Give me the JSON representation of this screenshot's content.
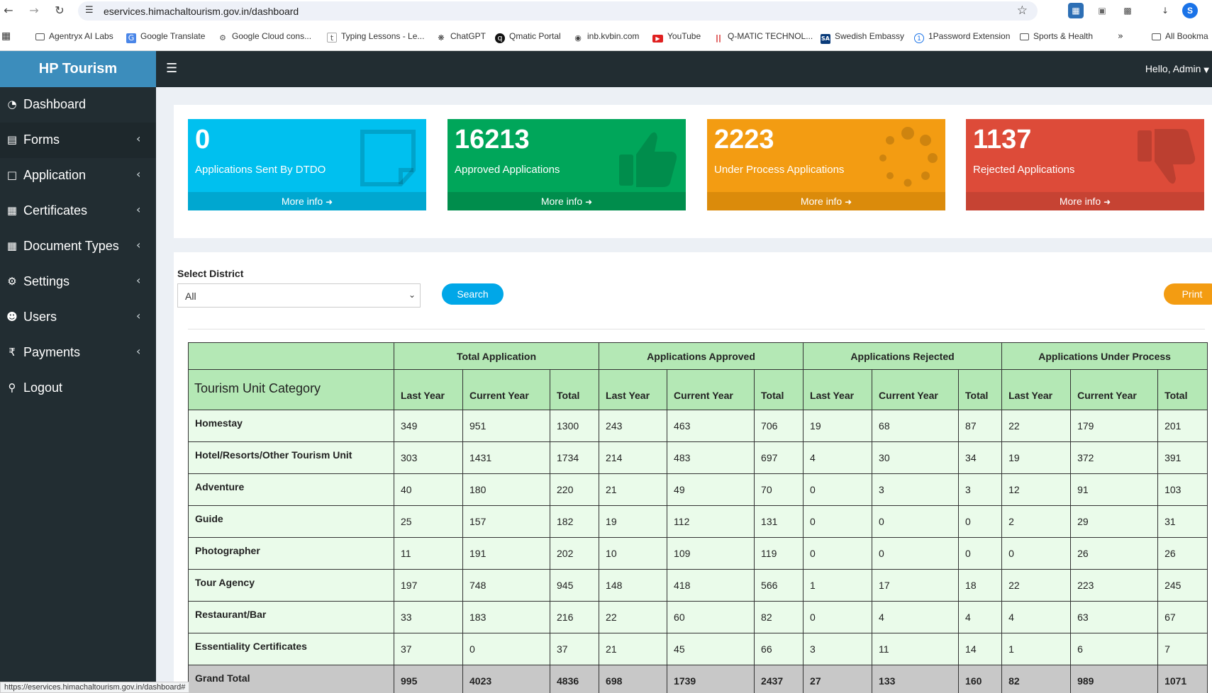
{
  "browser": {
    "url": "eservices.himachaltourism.gov.in/dashboard",
    "profile_initial": "S",
    "status_url": "https://eservices.himachaltourism.gov.in/dashboard#",
    "bookmarks": [
      {
        "label": "Agentryx AI Labs",
        "icon": "folder-icon"
      },
      {
        "label": "Google Translate",
        "icon": "translate-icon"
      },
      {
        "label": "Google Cloud cons...",
        "icon": "cloud-icon"
      },
      {
        "label": "Typing Lessons - Le...",
        "icon": "typing-icon"
      },
      {
        "label": "ChatGPT",
        "icon": "chatgpt-icon"
      },
      {
        "label": "Qmatic Portal",
        "icon": "qmatic-icon"
      },
      {
        "label": "inb.kvbin.com",
        "icon": "globe-icon"
      },
      {
        "label": "YouTube",
        "icon": "youtube-icon"
      },
      {
        "label": "Q-MATIC TECHNOL...",
        "icon": "qmatic-tech-icon"
      },
      {
        "label": "Swedish Embassy",
        "icon": "embassy-icon"
      },
      {
        "label": "1Password Extension",
        "icon": "1password-icon"
      },
      {
        "label": "Sports & Health",
        "icon": "folder-icon"
      }
    ],
    "all_bookmarks_label": "All Bookma"
  },
  "app": {
    "brand": "HP Tourism",
    "greeting": "Hello, Admin"
  },
  "sidebar": {
    "items": [
      {
        "label": "Dashboard",
        "icon": "dashboard-icon",
        "has_submenu": false
      },
      {
        "label": "Forms",
        "icon": "file-icon",
        "has_submenu": true
      },
      {
        "label": "Application",
        "icon": "file-outline-icon",
        "has_submenu": true
      },
      {
        "label": "Certificates",
        "icon": "file-excel-icon",
        "has_submenu": true
      },
      {
        "label": "Document Types",
        "icon": "file-excel-icon",
        "has_submenu": true
      },
      {
        "label": "Settings",
        "icon": "gear-icon",
        "has_submenu": true
      },
      {
        "label": "Users",
        "icon": "users-icon",
        "has_submenu": true
      },
      {
        "label": "Payments",
        "icon": "rupee-icon",
        "has_submenu": true
      },
      {
        "label": "Logout",
        "icon": "key-icon",
        "has_submenu": false
      }
    ]
  },
  "stats": [
    {
      "value": "0",
      "label": "Applications Sent By DTDO",
      "more": "More info",
      "color": "#00c0ef",
      "footer_color": "#00a7d0",
      "icon": "sticky-note-icon"
    },
    {
      "value": "16213",
      "label": "Approved Applications",
      "more": "More info",
      "color": "#00a65a",
      "footer_color": "#008d4c",
      "icon": "thumbs-up-icon"
    },
    {
      "value": "2223",
      "label": "Under Process Applications",
      "more": "More info",
      "color": "#f39c12",
      "footer_color": "#db8b0b",
      "icon": "spinner-icon"
    },
    {
      "value": "1137",
      "label": "Rejected Applications",
      "more": "More info",
      "color": "#dd4b39",
      "footer_color": "#c64333",
      "icon": "thumbs-down-icon"
    }
  ],
  "filter": {
    "label": "Select District",
    "selected": "All",
    "search_label": "Search",
    "print_label": "Print"
  },
  "table": {
    "category_header": "Tourism Unit Category",
    "groups": [
      "Total Application",
      "Applications Approved",
      "Applications Rejected",
      "Applications Under Process"
    ],
    "subheaders": [
      "Last Year",
      "Current Year",
      "Total",
      "Last Year",
      "Current Year",
      "Total",
      "Last Year",
      "Current Year",
      "Total",
      "Last Year",
      "Current Year",
      "Total"
    ],
    "rows": [
      {
        "category": "Homestay",
        "values": [
          "349",
          "951",
          "1300",
          "243",
          "463",
          "706",
          "19",
          "68",
          "87",
          "22",
          "179",
          "201"
        ]
      },
      {
        "category": "Hotel/Resorts/Other Tourism Unit",
        "values": [
          "303",
          "1431",
          "1734",
          "214",
          "483",
          "697",
          "4",
          "30",
          "34",
          "19",
          "372",
          "391"
        ]
      },
      {
        "category": "Adventure",
        "values": [
          "40",
          "180",
          "220",
          "21",
          "49",
          "70",
          "0",
          "3",
          "3",
          "12",
          "91",
          "103"
        ]
      },
      {
        "category": "Guide",
        "values": [
          "25",
          "157",
          "182",
          "19",
          "112",
          "131",
          "0",
          "0",
          "0",
          "2",
          "29",
          "31"
        ]
      },
      {
        "category": "Photographer",
        "values": [
          "11",
          "191",
          "202",
          "10",
          "109",
          "119",
          "0",
          "0",
          "0",
          "0",
          "26",
          "26"
        ]
      },
      {
        "category": "Tour Agency",
        "values": [
          "197",
          "748",
          "945",
          "148",
          "418",
          "566",
          "1",
          "17",
          "18",
          "22",
          "223",
          "245"
        ]
      },
      {
        "category": "Restaurant/Bar",
        "values": [
          "33",
          "183",
          "216",
          "22",
          "60",
          "82",
          "0",
          "4",
          "4",
          "4",
          "63",
          "67"
        ]
      },
      {
        "category": "Essentiality Certificates",
        "values": [
          "37",
          "0",
          "37",
          "21",
          "45",
          "66",
          "3",
          "11",
          "14",
          "1",
          "6",
          "7"
        ]
      }
    ],
    "grand_total": {
      "category": "Grand Total",
      "values": [
        "995",
        "4023",
        "4836",
        "698",
        "1739",
        "2437",
        "27",
        "133",
        "160",
        "82",
        "989",
        "1071"
      ]
    }
  }
}
